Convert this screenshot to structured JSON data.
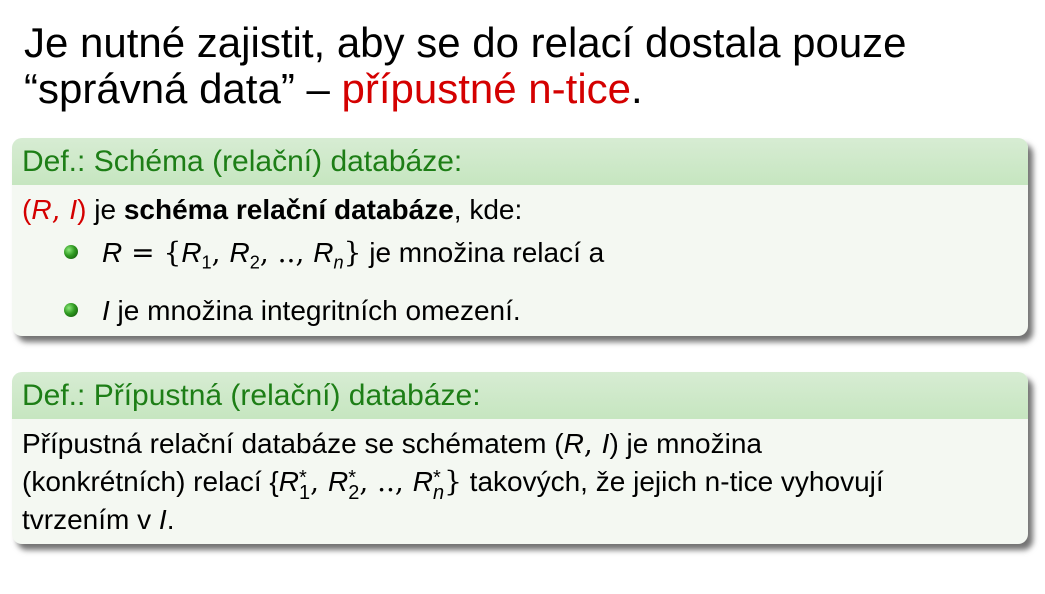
{
  "title": {
    "part1": "Je nutné zajistit, aby se do relací dostala pouze",
    "part2": "“správná data” – ",
    "highlight": "přípustné n-tice",
    "end": "."
  },
  "def1": {
    "heading": "Def.: Schéma (relační) databáze:",
    "intro": {
      "tuple_open": "(",
      "R": "R",
      "comma": ", ",
      "I": "I",
      "tuple_close": ")",
      "je": " je ",
      "bold": "schéma relační databáze",
      "rest": ", kde:"
    },
    "bullets": [
      {
        "var": "R",
        "eq": " = {",
        "r1": "R",
        "s1": "1",
        "sep1": ", ",
        "r2": "R",
        "s2": "2",
        "sep2": ", .., ",
        "rn": "R",
        "sn": "n",
        "close": "}",
        "text": " je množina relací a"
      },
      {
        "var": "I",
        "text": " je množina integritních omezení."
      }
    ]
  },
  "def2": {
    "heading": "Def.: Přípustná (relační) databáze:",
    "line1_a": "Přípustná relační databáze se schématem (",
    "line1_R": "R",
    "line1_sep": ", ",
    "line1_I": "I",
    "line1_b": ") je množina",
    "line2_a": "(konkrétních) relací {",
    "line2_r1": "R",
    "line2_sup1": "*",
    "line2_sub1": "1",
    "line2_sep1": ", ",
    "line2_r2": "R",
    "line2_sup2": "*",
    "line2_sub2": "2",
    "line2_sep2": ", .., ",
    "line2_rn": "R",
    "line2_supn": "*",
    "line2_subn": "n",
    "line2_close": "}",
    "line2_b": " takových, že jejich n-tice vyhovují",
    "line3_a": "tvrzením v ",
    "line3_I": "I",
    "line3_b": "."
  },
  "colors": {
    "accent_red": "#d40000",
    "block_title_green": "#1d7e16",
    "block_title_bg": "#c6e6c0",
    "block_body_bg": "#f4f8f2"
  }
}
